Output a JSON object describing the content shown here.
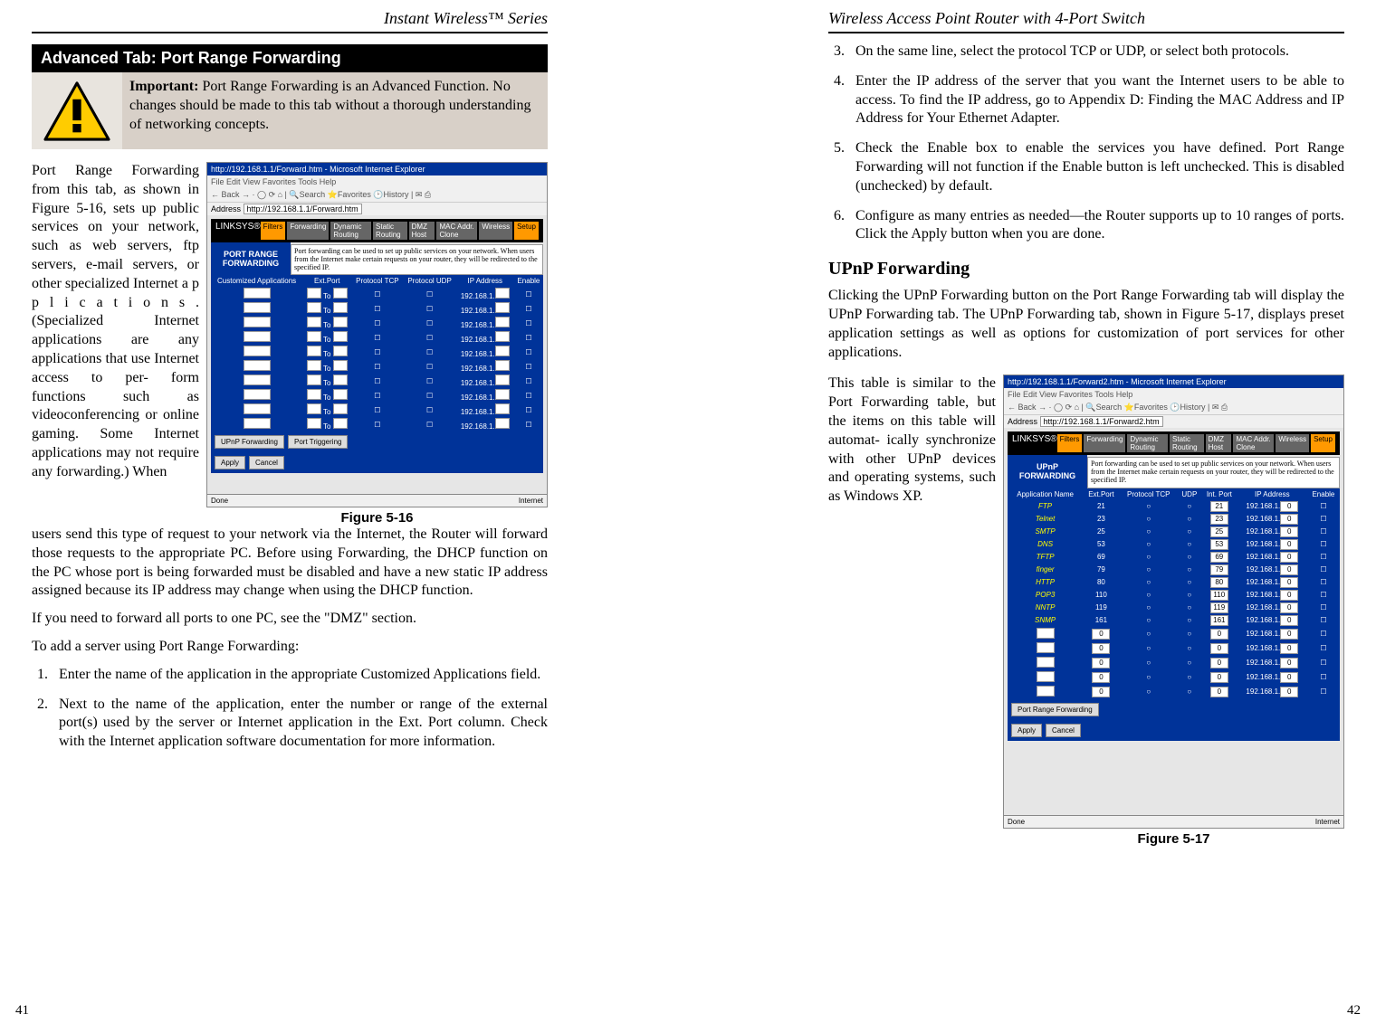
{
  "left_page": {
    "header": "Instant Wireless™ Series",
    "section_title": "Advanced Tab: Port Range Forwarding",
    "important_label": "Important:",
    "important_text": "  Port Range Forwarding is an Advanced Function. No changes should be made to this tab without a thorough understanding of networking concepts.",
    "flow_text": "Port Range Forwarding from this tab, as shown in Figure 5-16, sets up public services on your network, such as web servers, ftp servers, e-mail servers, or other specialized Internet a p p l i c a t i o n s . (Specialized Internet applications are any applications that use Internet access to per- form functions such as videoconferencing or online gaming. Some Internet applications may not require any forwarding.) When",
    "figure_caption": "Figure 5-16",
    "continuation": "users send this type of request to your network via the Internet, the Router will forward those requests to the appropriate PC.  Before using Forwarding, the DHCP function on the PC whose port is being forwarded must be disabled and have a new static IP address assigned because its IP address may change when using the DHCP function.",
    "dmz_para": "If you need to forward all ports to one PC, see the \"DMZ\" section.",
    "add_server": "To add a server using Port Range Forwarding:",
    "step1": "Enter the name of the application in the appropriate Customized Applications field.",
    "step2": "Next to the name of the application, enter the number or range of the external port(s) used by the server or Internet application in the Ext. Port column. Check with the Internet application software documentation for more information.",
    "page_num": "41",
    "screenshot": {
      "titlebar": "http://192.168.1.1/Forward.htm - Microsoft Internet Explorer",
      "menubar": "File  Edit  View  Favorites  Tools  Help",
      "toolbar": "← Back → · ◯ ⟳ ⌂ | 🔍Search ⭐Favorites 🕑History | ✉ ⎙",
      "address_label": "Address",
      "address": "http://192.168.1.1/Forward.htm",
      "brand": "LINKSYS®",
      "tabs": {
        "filters": "Filters",
        "forwarding": "Forwarding",
        "dynamic": "Dynamic Routing",
        "static": "Static Routing",
        "dmz": "DMZ Host",
        "mac": "MAC Addr. Clone",
        "wireless": "Wireless",
        "setup": "Setup"
      },
      "side_label": "PORT RANGE FORWARDING",
      "note": "Port forwarding can be used to set up public services on your network. When users from the Internet make certain requests on your router, they will be redirected to the specified IP.",
      "table_header": {
        "ca": "Customized Applications",
        "ext": "Ext.Port",
        "tcp": "Protocol TCP",
        "udp": "Protocol UDP",
        "ip": "IP Address",
        "enable": "Enable"
      },
      "to_label": "To",
      "ip_prefix": "192.168.1.",
      "sub_buttons": {
        "upnp": "UPnP Forwarding",
        "triggering": "Port Triggering"
      },
      "bottom_buttons": {
        "apply": "Apply",
        "cancel": "Cancel"
      },
      "status_left": "Done",
      "status_right": "Internet"
    }
  },
  "right_page": {
    "header": "Wireless Access Point Router with 4-Port Switch",
    "step3": "On the same line, select the protocol TCP or UDP, or select both protocols.",
    "step4": "Enter the IP address of the server that you want the Internet users to be able to access. To find the IP address, go to Appendix D: Finding the MAC Address and IP Address for Your Ethernet Adapter.",
    "step5": "Check the Enable box to enable the services you have defined. Port Range Forwarding will not function if the Enable button is left unchecked. This is disabled (unchecked) by default.",
    "step6": "Configure as many entries as needed—the Router supports up to 10 ranges of ports. Click the Apply button when you are done.",
    "subhead": "UPnP Forwarding",
    "upnp_para": "Clicking the UPnP Forwarding button on the Port Range Forwarding tab will display the UPnP Forwarding tab. The UPnP Forwarding tab, shown in Figure 5-17, displays preset application settings as well as options for customization of port services for other applications.",
    "upnp_side": "This table is similar to the Port Forwarding table, but the items on this table will automat- ically synchronize with other UPnP devices and operating systems, such as Windows XP.",
    "figure_caption": "Figure 5-17",
    "page_num": "42",
    "screenshot": {
      "titlebar": "http://192.168.1.1/Forward2.htm - Microsoft Internet Explorer",
      "menubar": "File  Edit  View  Favorites  Tools  Help",
      "toolbar": "← Back → · ◯ ⟳ ⌂ | 🔍Search ⭐Favorites 🕑History | ✉ ⎙",
      "address_label": "Address",
      "address": "http://192.168.1.1/Forward2.htm",
      "brand": "LINKSYS®",
      "tabs": {
        "filters": "Filters",
        "forwarding": "Forwarding",
        "dynamic": "Dynamic Routing",
        "static": "Static Routing",
        "dmz": "DMZ Host",
        "mac": "MAC Addr. Clone",
        "wireless": "Wireless",
        "setup": "Setup"
      },
      "side_label": "UPnP FORWARDING",
      "note": "Port forwarding can be used to set up public services on your network. When users from the Internet make certain requests on your router, they will be redirected to the specified IP.",
      "table_header": {
        "app": "Application Name",
        "ext": "Ext.Port",
        "tcp": "Protocol TCP",
        "udp": "UDP",
        "intport": "Int. Port",
        "ip": "IP Address",
        "enable": "Enable"
      },
      "ip_prefix": "192.168.1.",
      "rows": [
        {
          "app": "FTP",
          "ext": "21",
          "int": "21"
        },
        {
          "app": "Telnet",
          "ext": "23",
          "int": "23"
        },
        {
          "app": "SMTP",
          "ext": "25",
          "int": "25"
        },
        {
          "app": "DNS",
          "ext": "53",
          "int": "53"
        },
        {
          "app": "TFTP",
          "ext": "69",
          "int": "69"
        },
        {
          "app": "finger",
          "ext": "79",
          "int": "79"
        },
        {
          "app": "HTTP",
          "ext": "80",
          "int": "80"
        },
        {
          "app": "POP3",
          "ext": "110",
          "int": "110"
        },
        {
          "app": "NNTP",
          "ext": "119",
          "int": "119"
        },
        {
          "app": "SNMP",
          "ext": "161",
          "int": "161"
        },
        {
          "app": "",
          "ext": "0",
          "int": "0"
        },
        {
          "app": "",
          "ext": "0",
          "int": "0"
        },
        {
          "app": "",
          "ext": "0",
          "int": "0"
        },
        {
          "app": "",
          "ext": "0",
          "int": "0"
        },
        {
          "app": "",
          "ext": "0",
          "int": "0"
        }
      ],
      "sub_buttons": {
        "portrange": "Port Range Forwarding"
      },
      "bottom_buttons": {
        "apply": "Apply",
        "cancel": "Cancel"
      },
      "status_left": "Done",
      "status_right": "Internet"
    }
  }
}
